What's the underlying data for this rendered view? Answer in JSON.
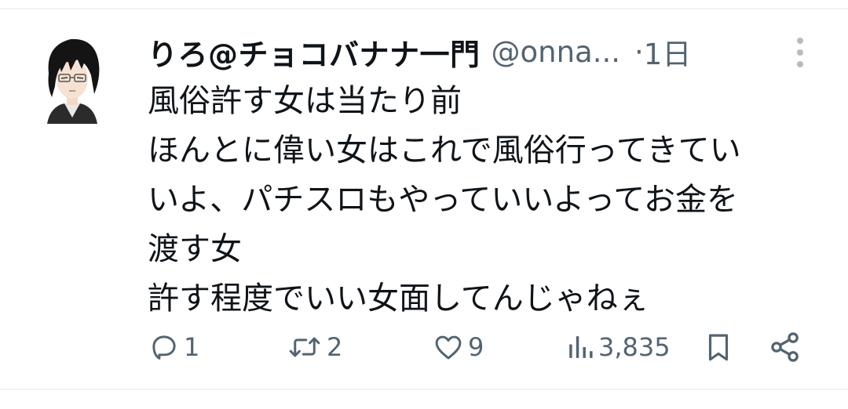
{
  "tweet": {
    "display_name": "りろ@チョコバナナ一門",
    "handle": "@onna...",
    "separator": "·",
    "time": "1日",
    "text_lines": [
      "風俗許す女は当たり前",
      "ほんとに偉い女はこれで風俗行ってきてい",
      "いよ、パチスロもやっていいよってお金を",
      "渡す女",
      "許す程度でいい女面してんじゃねぇ"
    ]
  },
  "actions": {
    "reply": {
      "icon": "reply-icon",
      "count": "1"
    },
    "retweet": {
      "icon": "retweet-icon",
      "count": "2"
    },
    "like": {
      "icon": "heart-icon",
      "count": "9"
    },
    "views": {
      "icon": "views-chart-icon",
      "count": "3,835"
    },
    "bookmark": {
      "icon": "bookmark-icon"
    },
    "share": {
      "icon": "share-icon"
    }
  },
  "colors": {
    "text_primary": "#0f1419",
    "text_secondary": "#536471",
    "divider": "#eff3f4",
    "more_dots": "#b4bcc2"
  }
}
